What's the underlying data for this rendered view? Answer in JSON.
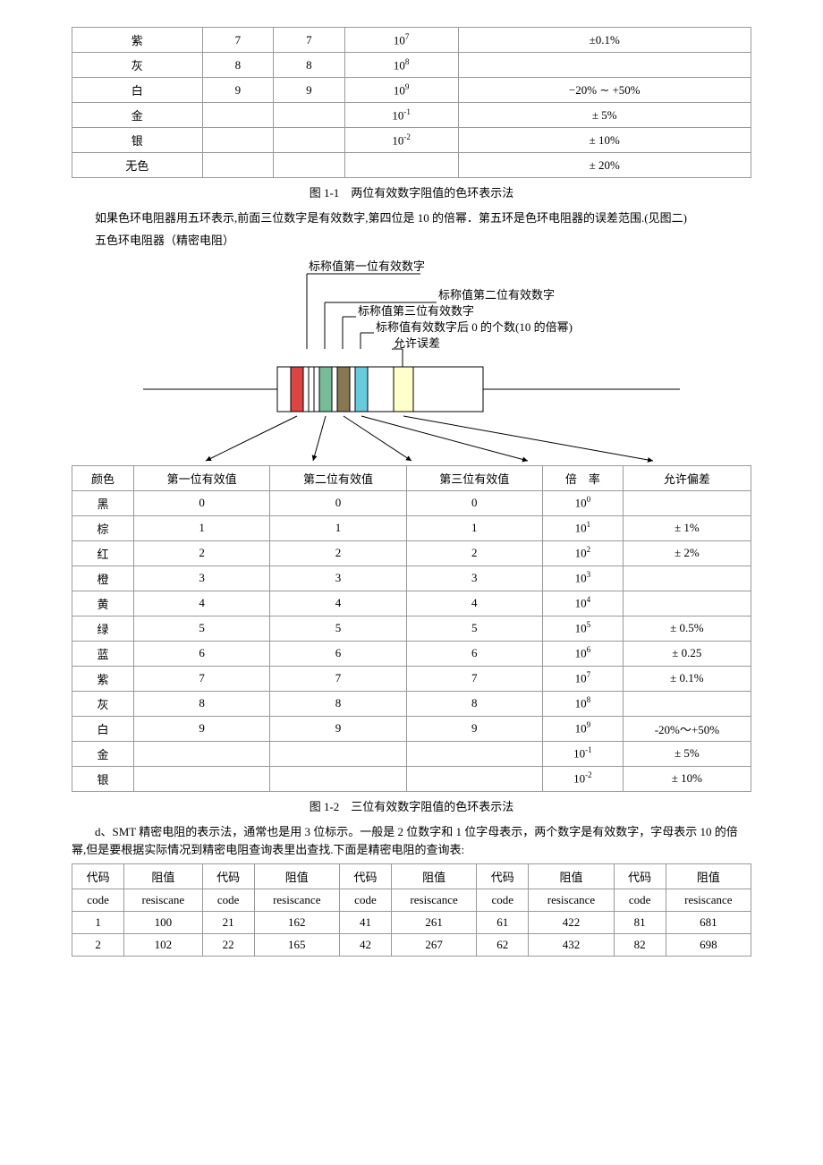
{
  "table1": {
    "rows": [
      {
        "color": "紫",
        "d1": "7",
        "d2": "7",
        "mult_base": "10",
        "mult_exp": "7",
        "tol": "±0.1%"
      },
      {
        "color": "灰",
        "d1": "8",
        "d2": "8",
        "mult_base": "10",
        "mult_exp": "8",
        "tol": ""
      },
      {
        "color": "白",
        "d1": "9",
        "d2": "9",
        "mult_base": "10",
        "mult_exp": "9",
        "tol": "−20% ∼ +50%"
      },
      {
        "color": "金",
        "d1": "",
        "d2": "",
        "mult_base": "10",
        "mult_exp": "-1",
        "tol": "± 5%"
      },
      {
        "color": "银",
        "d1": "",
        "d2": "",
        "mult_base": "10",
        "mult_exp": "-2",
        "tol": "± 10%"
      },
      {
        "color": "无色",
        "d1": "",
        "d2": "",
        "mult_base": "",
        "mult_exp": "",
        "tol": "± 20%"
      }
    ],
    "caption": "图 1-1　两位有效数字阻值的色环表示法"
  },
  "paragraphs": {
    "p1": "如果色环电阻器用五环表示,前面三位数字是有效数字,第四位是 10 的倍幂．第五环是色环电阻器的误差范围.(见图二)",
    "p2": "五色环电阻器（精密电阻）"
  },
  "diagram": {
    "l1": "标称值第一位有效数字",
    "l2": "标称值第二位有效数字",
    "l3": "标称值第三位有效数字",
    "l4": "标称值有效数字后 0 的个数(10 的倍幂)",
    "l5": "允许误差"
  },
  "table2": {
    "headers": {
      "color": "颜色",
      "d1": "第一位有效值",
      "d2": "第二位有效值",
      "d3": "第三位有效值",
      "mult": "倍　率",
      "tol": "允许偏差"
    },
    "rows": [
      {
        "color": "黑",
        "d1": "0",
        "d2": "0",
        "d3": "0",
        "mult_base": "10",
        "mult_exp": "0",
        "tol": ""
      },
      {
        "color": "棕",
        "d1": "1",
        "d2": "1",
        "d3": "1",
        "mult_base": "10",
        "mult_exp": "1",
        "tol": "± 1%"
      },
      {
        "color": "红",
        "d1": "2",
        "d2": "2",
        "d3": "2",
        "mult_base": "10",
        "mult_exp": "2",
        "tol": "± 2%"
      },
      {
        "color": "橙",
        "d1": "3",
        "d2": "3",
        "d3": "3",
        "mult_base": "10",
        "mult_exp": "3",
        "tol": ""
      },
      {
        "color": "黄",
        "d1": "4",
        "d2": "4",
        "d3": "4",
        "mult_base": "10",
        "mult_exp": "4",
        "tol": ""
      },
      {
        "color": "绿",
        "d1": "5",
        "d2": "5",
        "d3": "5",
        "mult_base": "10",
        "mult_exp": "5",
        "tol": "± 0.5%"
      },
      {
        "color": "蓝",
        "d1": "6",
        "d2": "6",
        "d3": "6",
        "mult_base": "10",
        "mult_exp": "6",
        "tol": "± 0.25"
      },
      {
        "color": "紫",
        "d1": "7",
        "d2": "7",
        "d3": "7",
        "mult_base": "10",
        "mult_exp": "7",
        "tol": "± 0.1%"
      },
      {
        "color": "灰",
        "d1": "8",
        "d2": "8",
        "d3": "8",
        "mult_base": "10",
        "mult_exp": "8",
        "tol": ""
      },
      {
        "color": "白",
        "d1": "9",
        "d2": "9",
        "d3": "9",
        "mult_base": "10",
        "mult_exp": "9",
        "tol": "-20%～+50%"
      },
      {
        "color": "金",
        "d1": "",
        "d2": "",
        "d3": "",
        "mult_base": "10",
        "mult_exp": "-1",
        "tol": "± 5%"
      },
      {
        "color": "银",
        "d1": "",
        "d2": "",
        "d3": "",
        "mult_base": "10",
        "mult_exp": "-2",
        "tol": "± 10%"
      }
    ],
    "caption": "图 1-2　三位有效数字阻值的色环表示法"
  },
  "paragraphs2": {
    "p3": "d、SMT 精密电阻的表示法，通常也是用 3 位标示。一般是 2 位数字和 1 位字母表示，两个数字是有效数字，字母表示 10 的倍幂,但是要根据实际情况到精密电阻查询表里出查找.下面是精密电阻的查询表:"
  },
  "table3": {
    "headers": {
      "code": "代码",
      "value": "阻值",
      "code_en": "code",
      "value_en": "resiscance",
      "value_en1": "resiscane",
      "value_en2": "resiscance",
      "value_en3": "resiscance",
      "value_en4": "resiscance",
      "value_en5": "resiscance"
    },
    "rows": [
      {
        "c1": "1",
        "v1": "100",
        "c2": "21",
        "v2": "162",
        "c3": "41",
        "v3": "261",
        "c4": "61",
        "v4": "422",
        "c5": "81",
        "v5": "681"
      },
      {
        "c1": "2",
        "v1": "102",
        "c2": "22",
        "v2": "165",
        "c3": "42",
        "v3": "267",
        "c4": "62",
        "v4": "432",
        "c5": "82",
        "v5": "698"
      }
    ]
  }
}
